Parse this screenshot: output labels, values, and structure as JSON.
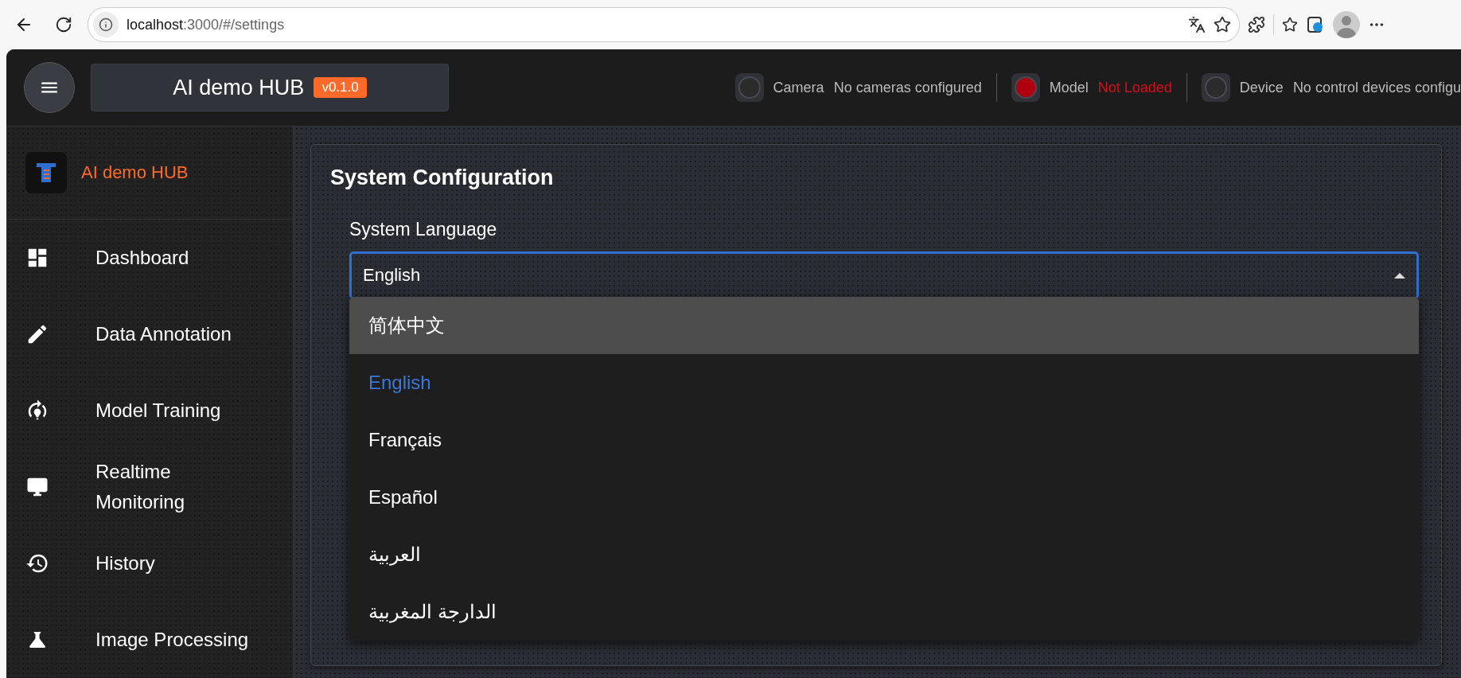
{
  "browser": {
    "url_host": "localhost",
    "url_path": ":3000/#/settings"
  },
  "header": {
    "title": "AI demo HUB",
    "version": "v0.1.0",
    "status": [
      {
        "label": "Camera",
        "value": "No cameras configured",
        "color": "#2b2b2b",
        "alert": false
      },
      {
        "label": "Model",
        "value": "Not Loaded",
        "color": "#b0000f",
        "alert": true
      },
      {
        "label": "Device",
        "value": "No control devices configu",
        "color": "#2b2b2b",
        "alert": false
      }
    ]
  },
  "sidebar": {
    "brand": "AI demo HUB",
    "items": [
      {
        "label": "Dashboard"
      },
      {
        "label": "Data Annotation"
      },
      {
        "label": "Model Training"
      },
      {
        "label": "Realtime Monitoring"
      },
      {
        "label": "History"
      },
      {
        "label": "Image Processing"
      }
    ]
  },
  "settings": {
    "title": "System Configuration",
    "language_label": "System Language",
    "language_value": "English",
    "options": [
      {
        "label": "简体中文",
        "selected": false,
        "hovered": true
      },
      {
        "label": "English",
        "selected": true,
        "hovered": false
      },
      {
        "label": "Français",
        "selected": false,
        "hovered": false
      },
      {
        "label": "Español",
        "selected": false,
        "hovered": false
      },
      {
        "label": "العربية",
        "selected": false,
        "hovered": false
      },
      {
        "label": "الدارجة المغربية",
        "selected": false,
        "hovered": false
      }
    ]
  }
}
